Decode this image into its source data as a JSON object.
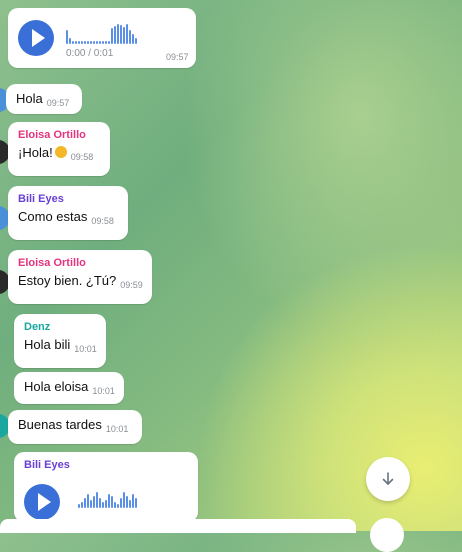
{
  "messages": {
    "voice_1": {
      "progress": "0:00 / 0:01",
      "time": "09:57"
    },
    "m1": {
      "text": "Hola",
      "time": "09:57"
    },
    "m2": {
      "sender": "Eloisa Ortillo",
      "text": "¡Hola!",
      "time": "09:58",
      "emoji": "smile-emoji"
    },
    "m3": {
      "sender": "Bili Eyes",
      "text": "Como estas",
      "time": "09:58"
    },
    "m4": {
      "sender": "Eloisa Ortillo",
      "text": "Estoy bien. ¿Tú?",
      "time": "09:59"
    },
    "m5": {
      "sender": "Denz",
      "text": "Hola bili",
      "time": "10:01"
    },
    "m6": {
      "text": "Hola eloisa",
      "time": "10:01"
    },
    "m7": {
      "text": "Buenas tardes",
      "time": "10:01"
    },
    "voice_2": {
      "sender": "Bili Eyes"
    }
  },
  "colors": {
    "eloisa": "#e5337f",
    "bili": "#6a3fd6",
    "denz": "#19a7a0",
    "play_button": "#3b6fd8",
    "waveform": "#5b8fe6"
  },
  "icons": {
    "scroll_down": "arrow-down-icon",
    "play": "play-icon"
  }
}
